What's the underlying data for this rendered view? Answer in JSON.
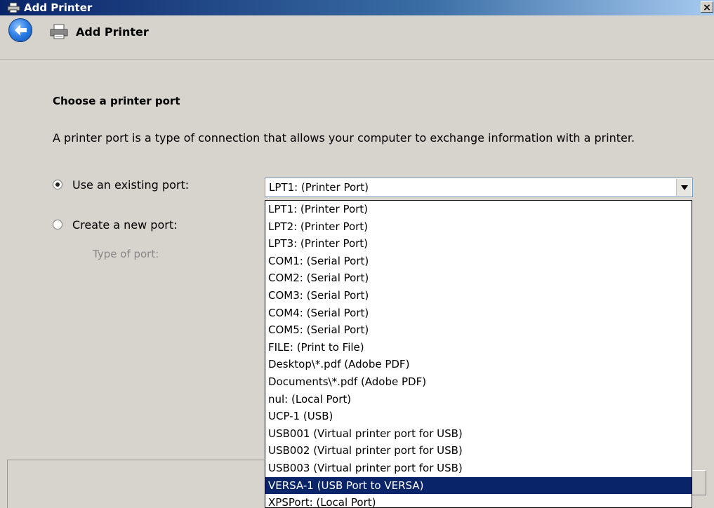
{
  "window": {
    "title": "Add Printer",
    "close_label": "×"
  },
  "header": {
    "title": "Add Printer",
    "back_icon": "back-arrow-icon",
    "printer_icon": "printer-icon"
  },
  "page": {
    "section_title": "Choose a printer port",
    "description": "A printer port is a type of connection that allows your computer to exchange information with a printer.",
    "existing_port_label": "Use an existing port:",
    "new_port_label": "Create a new port:",
    "type_of_port_label": "Type of port:",
    "existing_port_checked": true
  },
  "port_select": {
    "value": "LPT1: (Printer Port)",
    "options": [
      "LPT1: (Printer Port)",
      "LPT2: (Printer Port)",
      "LPT3: (Printer Port)",
      "COM1: (Serial Port)",
      "COM2: (Serial Port)",
      "COM3: (Serial Port)",
      "COM4: (Serial Port)",
      "COM5: (Serial Port)",
      "FILE: (Print to File)",
      "Desktop\\*.pdf (Adobe PDF)",
      "Documents\\*.pdf (Adobe PDF)",
      "nul: (Local Port)",
      "UCP-1 (USB)",
      "USB001 (Virtual printer port for USB)",
      "USB002 (Virtual printer port for USB)",
      "USB003 (Virtual printer port for USB)",
      "VERSA-1 (USB Port to VERSA)",
      "XPSPort: (Local Port)"
    ],
    "highlighted_option": "VERSA-1 (USB Port to VERSA)"
  },
  "colors": {
    "highlight": "#0a246a",
    "titlebar": "#0a246a",
    "dialog_bg": "#d7d3cd"
  }
}
